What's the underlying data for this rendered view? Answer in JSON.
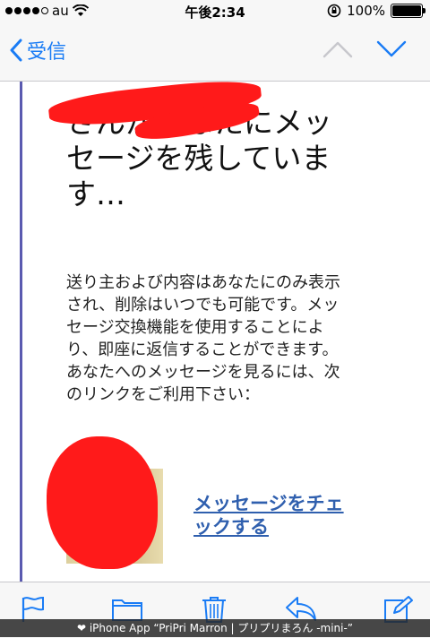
{
  "status": {
    "carrier": "au",
    "time": "午後2:34",
    "battery_percent": 100,
    "battery_label": "100%"
  },
  "nav": {
    "back_label": "受信"
  },
  "message": {
    "headline": "さんがあなたにメッセージを残しています…",
    "body": "送り主および内容はあなたにのみ表示され、削除はいつでも可能です。メッセージ交換機能を使用することにより、即座に返信することができます。あなたへのメッセージを見るには、次のリンクをご利用下さい：",
    "link_label": "メッセージをチェックする"
  },
  "banner": {
    "text": "iPhone App “PriPri Marron | プリプリまろん -mini-”"
  },
  "colors": {
    "accent": "#1a7cf5",
    "link": "#2f5fae",
    "redaction": "#ff1a1a",
    "quote_rule": "#5a5ab0"
  }
}
